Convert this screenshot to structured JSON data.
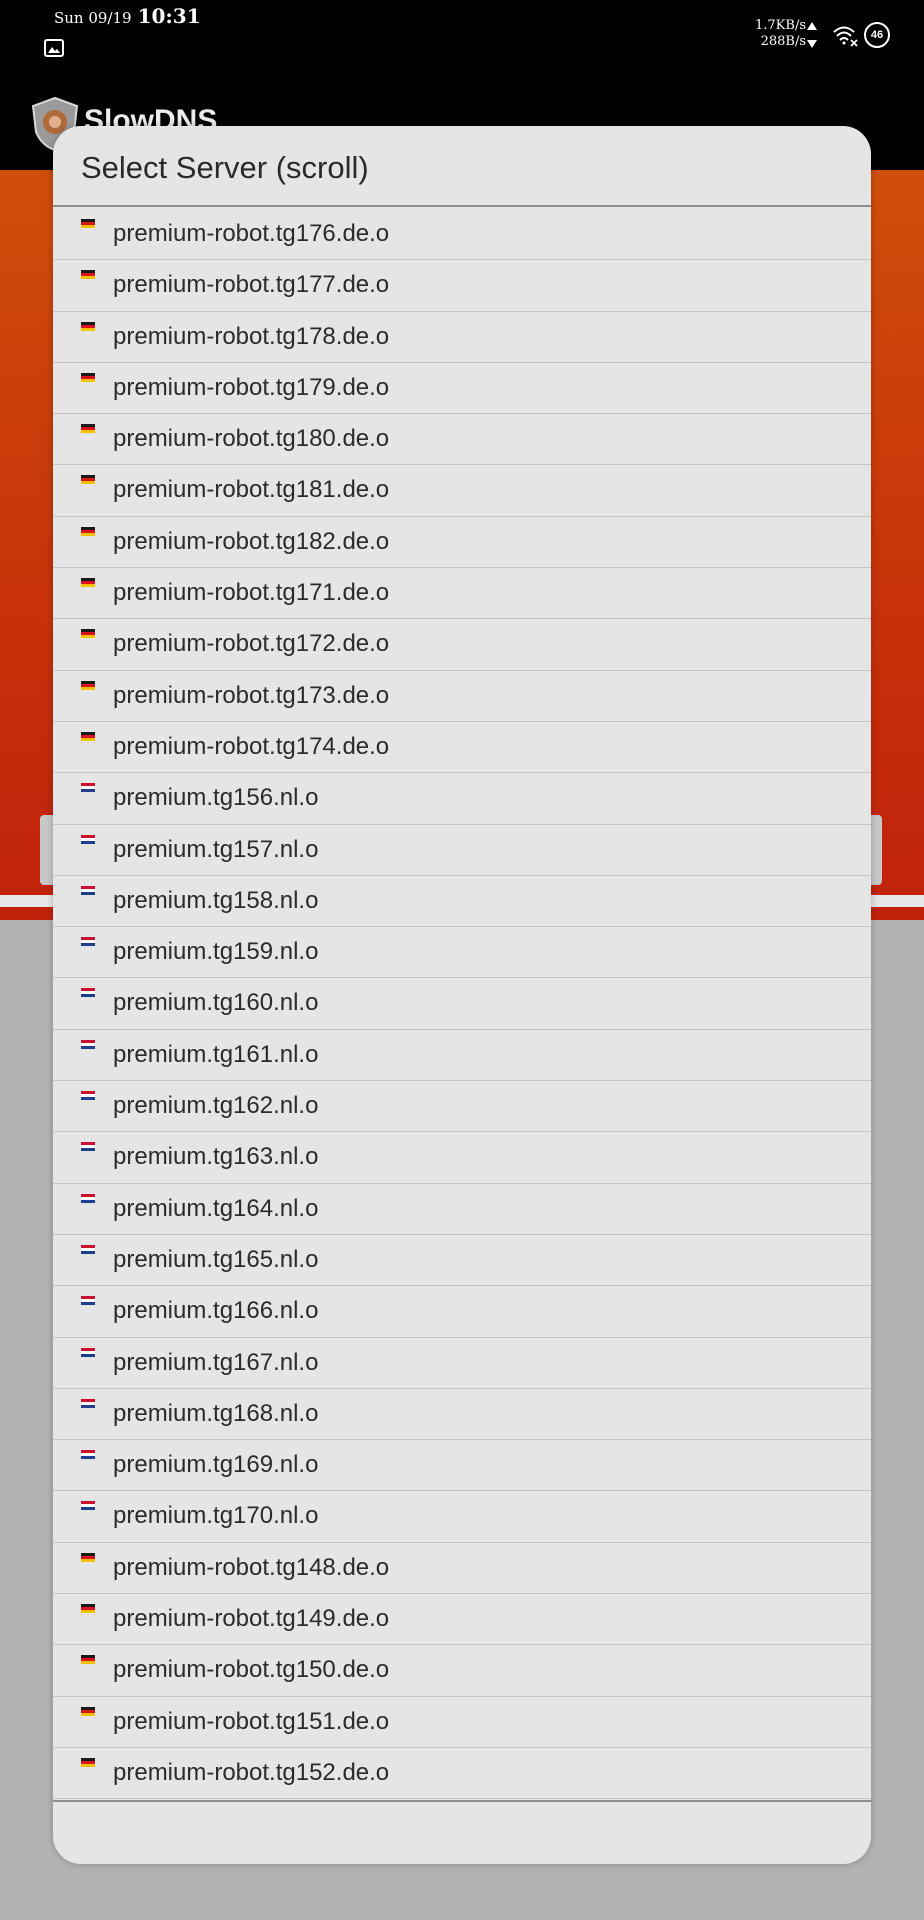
{
  "status_bar": {
    "date": "Sun 09/19",
    "time": "10:31",
    "upload_speed": "1.7KB/s",
    "download_speed": "288B/s",
    "battery": "46"
  },
  "app": {
    "title": "SlowDNS",
    "header_color": "#c7330a"
  },
  "dialog": {
    "title": "Select Server (scroll)"
  },
  "servers": [
    {
      "label": "premium-robot.tg176.de.o",
      "flag": "de"
    },
    {
      "label": "premium-robot.tg177.de.o",
      "flag": "de"
    },
    {
      "label": "premium-robot.tg178.de.o",
      "flag": "de"
    },
    {
      "label": "premium-robot.tg179.de.o",
      "flag": "de"
    },
    {
      "label": "premium-robot.tg180.de.o",
      "flag": "de"
    },
    {
      "label": "premium-robot.tg181.de.o",
      "flag": "de"
    },
    {
      "label": "premium-robot.tg182.de.o",
      "flag": "de"
    },
    {
      "label": "premium-robot.tg171.de.o",
      "flag": "de"
    },
    {
      "label": "premium-robot.tg172.de.o",
      "flag": "de"
    },
    {
      "label": "premium-robot.tg173.de.o",
      "flag": "de"
    },
    {
      "label": "premium-robot.tg174.de.o",
      "flag": "de"
    },
    {
      "label": "premium.tg156.nl.o",
      "flag": "nl"
    },
    {
      "label": "premium.tg157.nl.o",
      "flag": "nl"
    },
    {
      "label": "premium.tg158.nl.o",
      "flag": "nl"
    },
    {
      "label": "premium.tg159.nl.o",
      "flag": "nl"
    },
    {
      "label": "premium.tg160.nl.o",
      "flag": "nl"
    },
    {
      "label": "premium.tg161.nl.o",
      "flag": "nl"
    },
    {
      "label": "premium.tg162.nl.o",
      "flag": "nl"
    },
    {
      "label": "premium.tg163.nl.o",
      "flag": "nl"
    },
    {
      "label": "premium.tg164.nl.o",
      "flag": "nl"
    },
    {
      "label": "premium.tg165.nl.o",
      "flag": "nl"
    },
    {
      "label": "premium.tg166.nl.o",
      "flag": "nl"
    },
    {
      "label": "premium.tg167.nl.o",
      "flag": "nl"
    },
    {
      "label": "premium.tg168.nl.o",
      "flag": "nl"
    },
    {
      "label": "premium.tg169.nl.o",
      "flag": "nl"
    },
    {
      "label": "premium.tg170.nl.o",
      "flag": "nl"
    },
    {
      "label": "premium-robot.tg148.de.o",
      "flag": "de"
    },
    {
      "label": "premium-robot.tg149.de.o",
      "flag": "de"
    },
    {
      "label": "premium-robot.tg150.de.o",
      "flag": "de"
    },
    {
      "label": "premium-robot.tg151.de.o",
      "flag": "de"
    },
    {
      "label": "premium-robot.tg152.de.o",
      "flag": "de"
    }
  ]
}
